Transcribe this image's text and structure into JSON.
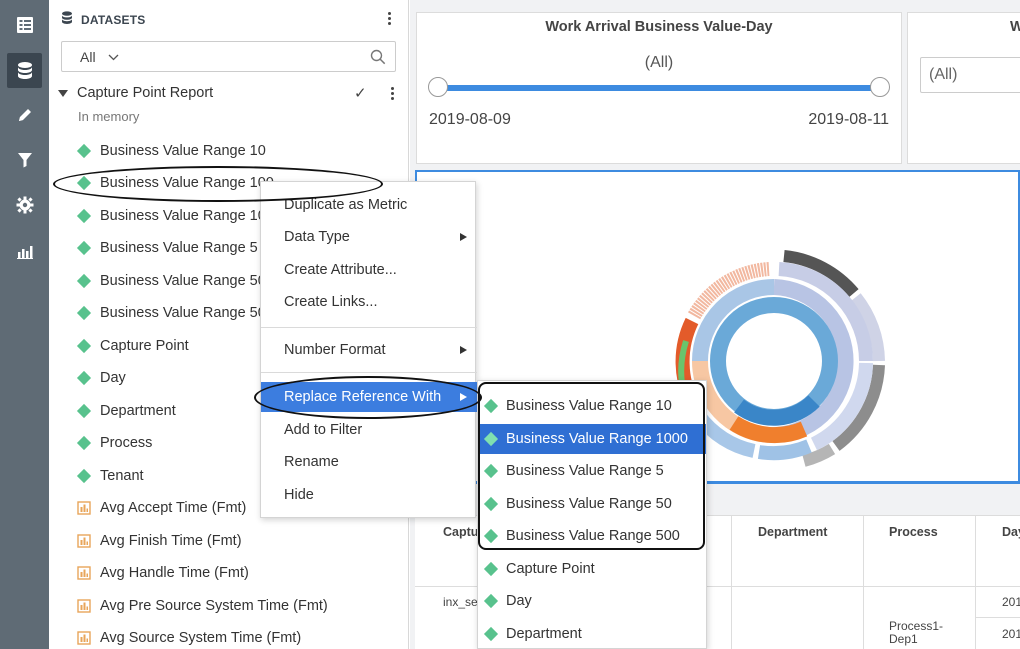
{
  "rail": {
    "icons": [
      "list-icon",
      "database-icon",
      "pencil-icon",
      "filter-icon",
      "gear-icon",
      "bar-chart-icon"
    ]
  },
  "panel": {
    "title": "DATASETS",
    "filter_value": "All",
    "report": {
      "name": "Capture Point Report",
      "subtitle": "In memory"
    },
    "attributes": [
      "Business Value Range 10",
      "Business Value Range 100",
      "Business Value Range 1000",
      "Business Value Range 5",
      "Business Value Range 50",
      "Business Value Range 500",
      "Capture Point",
      "Day",
      "Department",
      "Process",
      "Tenant"
    ],
    "metrics": [
      "Avg Accept Time (Fmt)",
      "Avg Finish Time (Fmt)",
      "Avg Handle Time (Fmt)",
      "Avg Pre Source System Time (Fmt)",
      "Avg Source System Time (Fmt)"
    ]
  },
  "filters": {
    "date_filter": {
      "title": "Work Arrival Business Value-Day",
      "selection": "(All)",
      "start": "2019-08-09",
      "end": "2019-08-11"
    },
    "second_filter": {
      "title": "W",
      "selection": "(All)"
    }
  },
  "grid": {
    "headers": [
      "Captu",
      "Department",
      "Process",
      "Day"
    ],
    "cells": {
      "capture": "inx_se",
      "process": "Process1-\nDep1",
      "day_1": "201",
      "day_2": "201"
    }
  },
  "context_menu": {
    "items": [
      {
        "label": "Duplicate as Metric"
      },
      {
        "label": "Data Type",
        "submenu": true
      },
      {
        "label": "Create Attribute..."
      },
      {
        "label": "Create Links..."
      },
      {
        "label": "Number Format",
        "submenu": true
      },
      {
        "label": "Replace Reference With",
        "submenu": true,
        "highlighted": true
      },
      {
        "label": "Add to Filter"
      },
      {
        "label": "Rename"
      },
      {
        "label": "Hide"
      }
    ]
  },
  "submenu": {
    "items": [
      "Business Value Range 10",
      "Business Value Range 1000",
      "Business Value Range 5",
      "Business Value Range 50",
      "Business Value Range 500",
      "Capture Point",
      "Day",
      "Department"
    ],
    "highlighted_label": "Business Value Range 1000"
  },
  "colors": {
    "accent": "#3c7ddf",
    "attribute_icon": "#58c28d",
    "metric_icon": "#e8a55a",
    "rail": "#5f6b75"
  }
}
